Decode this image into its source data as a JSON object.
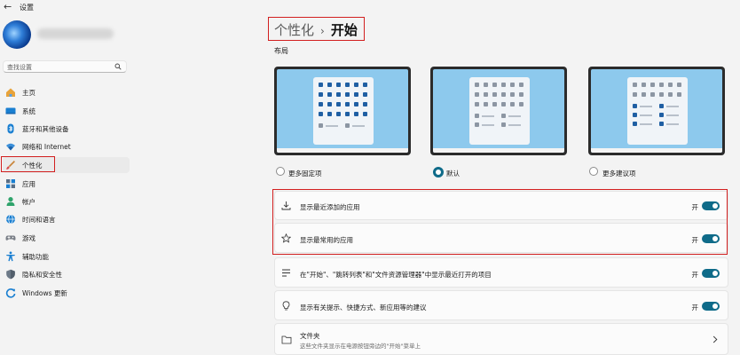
{
  "window": {
    "title": "设置"
  },
  "search": {
    "placeholder": "查找设置"
  },
  "sidebar": {
    "items": [
      {
        "label": "主页",
        "icon": "home-icon"
      },
      {
        "label": "系统",
        "icon": "system-icon"
      },
      {
        "label": "蓝牙和其他设备",
        "icon": "bluetooth-icon"
      },
      {
        "label": "网络和 Internet",
        "icon": "wifi-icon"
      },
      {
        "label": "个性化",
        "icon": "brush-icon",
        "selected": true
      },
      {
        "label": "应用",
        "icon": "apps-icon"
      },
      {
        "label": "帐户",
        "icon": "account-icon"
      },
      {
        "label": "时间和语言",
        "icon": "globe-icon"
      },
      {
        "label": "游戏",
        "icon": "gamepad-icon"
      },
      {
        "label": "辅助功能",
        "icon": "accessibility-icon"
      },
      {
        "label": "隐私和安全性",
        "icon": "shield-icon"
      },
      {
        "label": "Windows 更新",
        "icon": "update-icon"
      }
    ]
  },
  "breadcrumb": {
    "parent": "个性化",
    "separator": "›",
    "current": "开始"
  },
  "layout": {
    "heading": "布局",
    "options": [
      {
        "label": "更多固定项",
        "selected": false
      },
      {
        "label": "默认",
        "selected": true
      },
      {
        "label": "更多建议项",
        "selected": false
      }
    ]
  },
  "settings": [
    {
      "label": "显示最近添加的应用",
      "state": "开",
      "on": true,
      "icon": "download-icon"
    },
    {
      "label": "显示最常用的应用",
      "state": "开",
      "on": true,
      "icon": "star-icon"
    },
    {
      "label": "在\"开始\"、\"跳转列表\"和\"文件资源管理器\"中显示最近打开的项目",
      "state": "开",
      "on": true,
      "icon": "list-icon"
    },
    {
      "label": "显示有关提示、快捷方式、新应用等的建议",
      "state": "开",
      "on": true,
      "icon": "lightbulb-icon"
    }
  ],
  "folders": {
    "label": "文件夹",
    "sublabel": "这些文件夹显示在电源按钮旁边的\"开始\"菜单上"
  },
  "colors": {
    "accent": "#0f6b89",
    "highlight": "#d21f1f",
    "preview_bg": "#8dc9ed"
  }
}
